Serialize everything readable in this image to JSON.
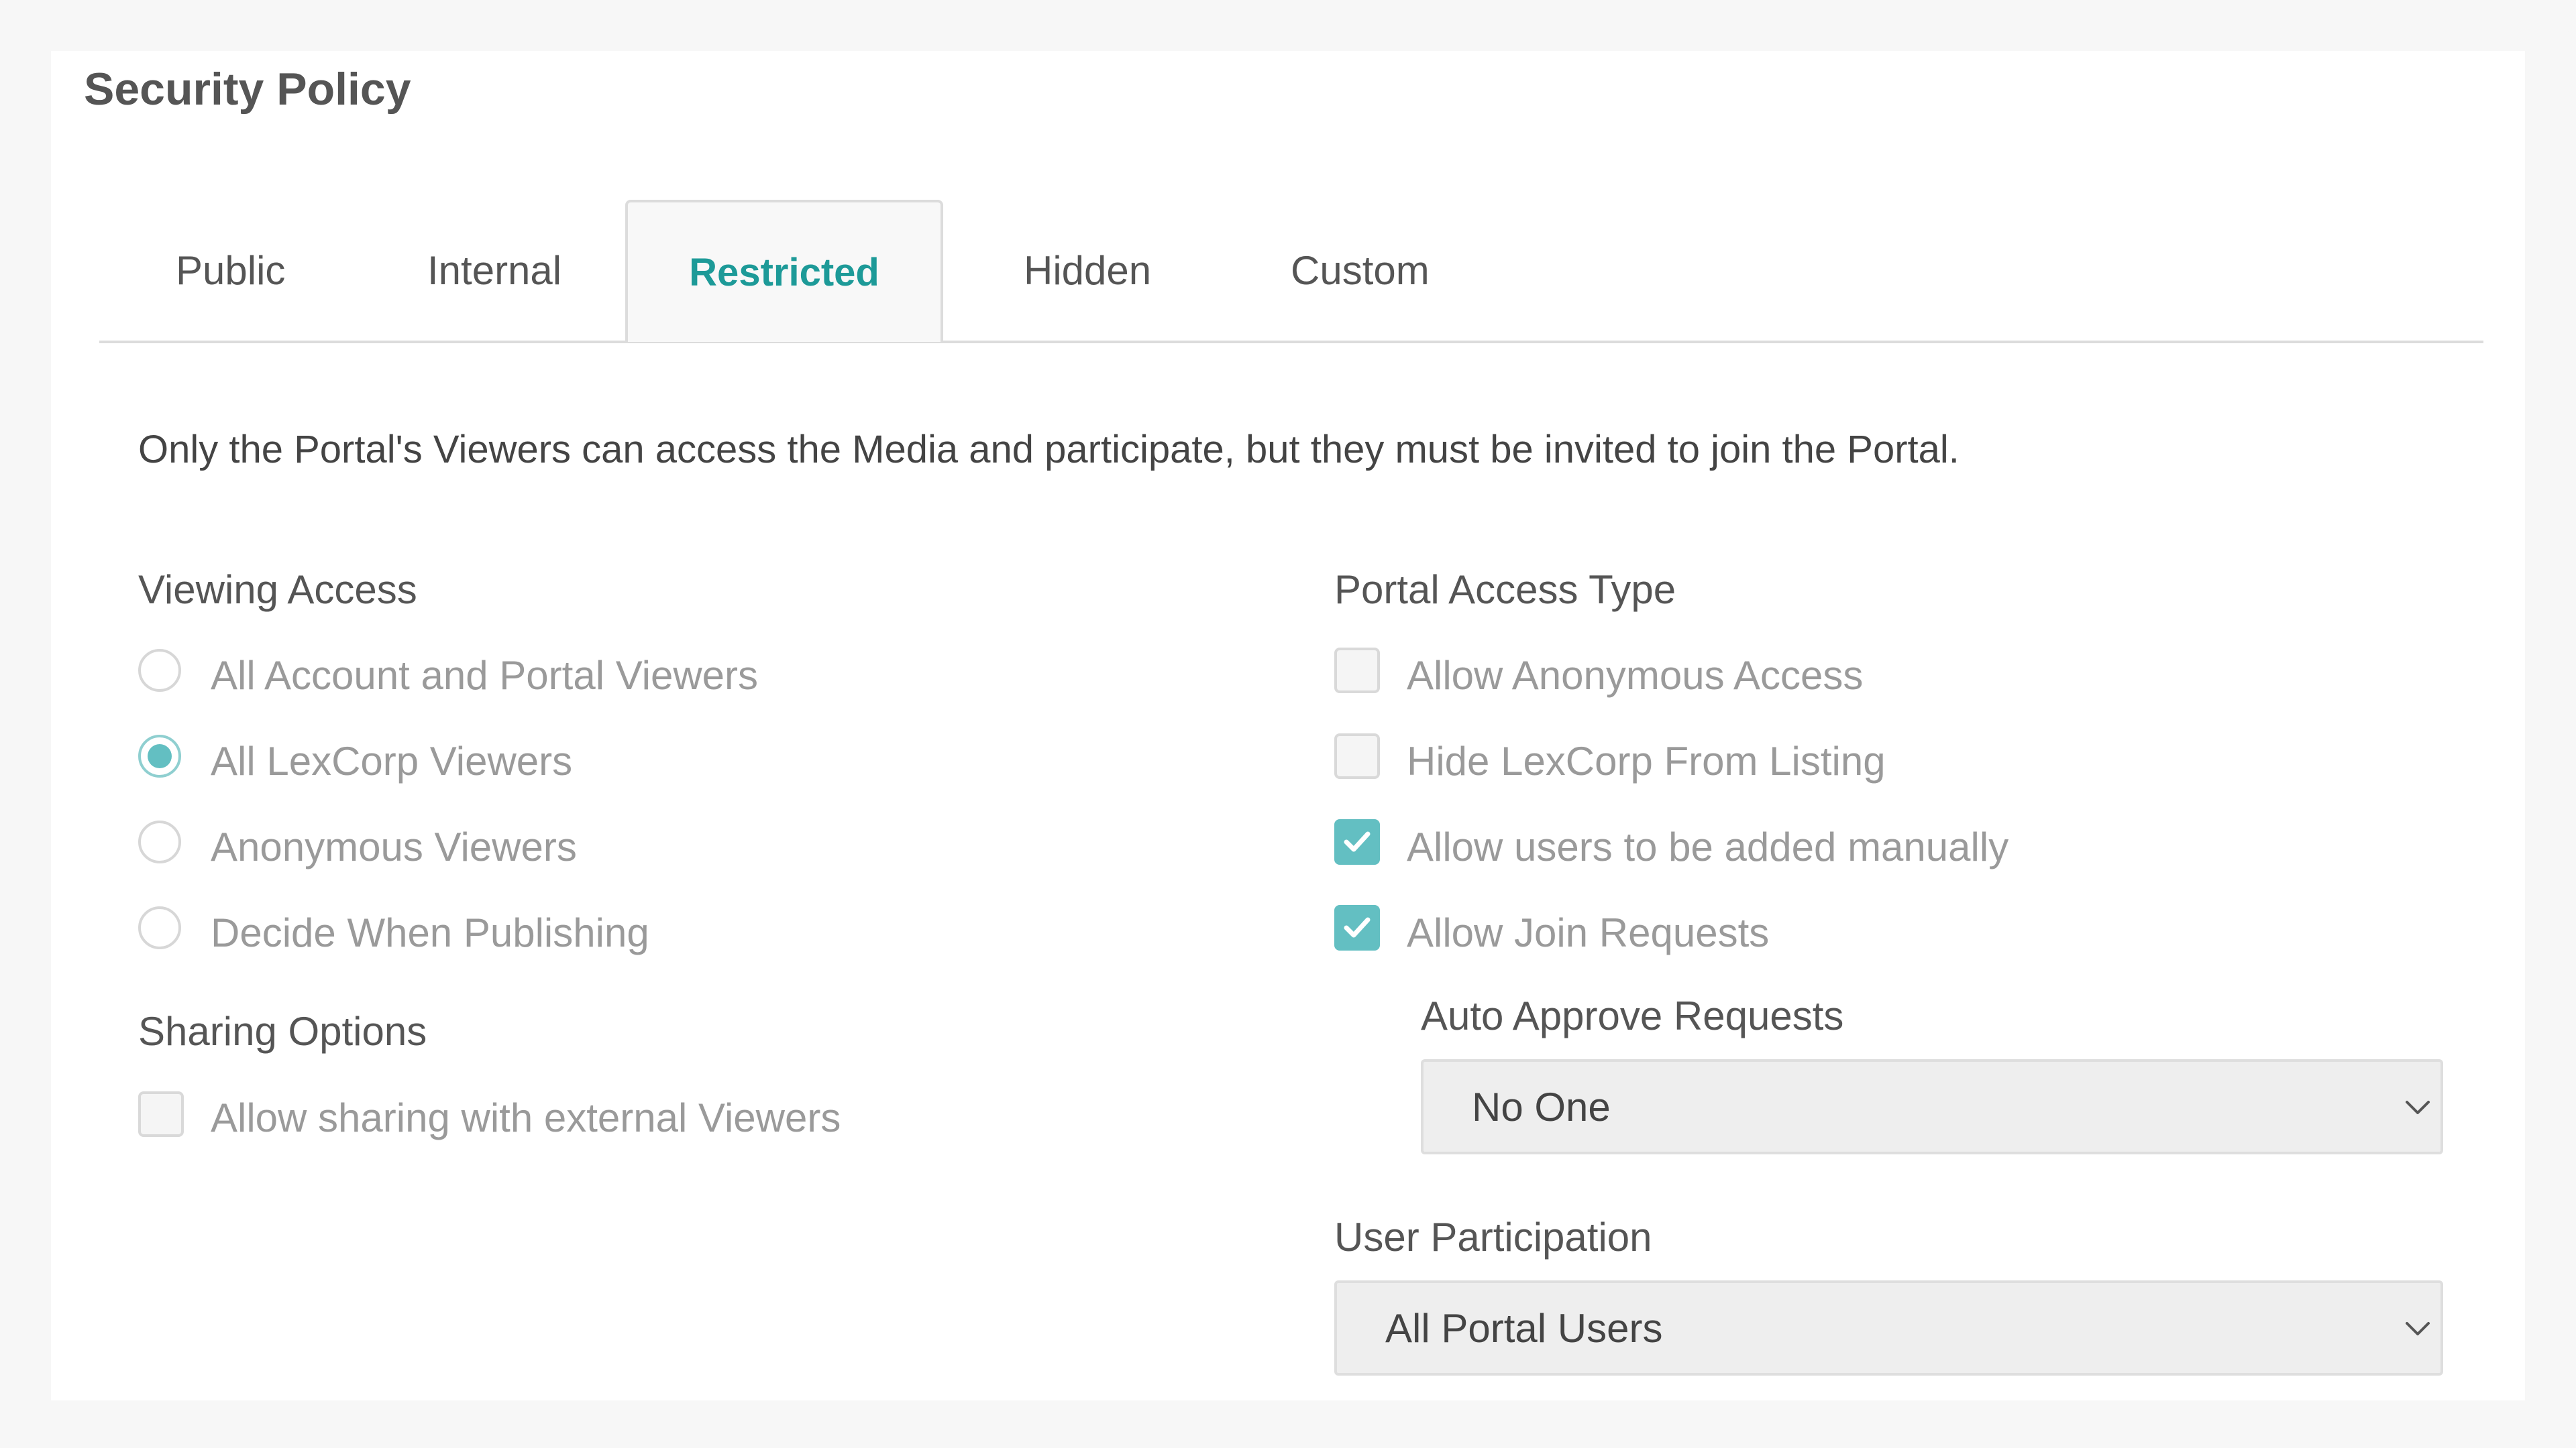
{
  "title": "Security Policy",
  "tabs": [
    {
      "label": "Public",
      "active": false
    },
    {
      "label": "Internal",
      "active": false
    },
    {
      "label": "Restricted",
      "active": true
    },
    {
      "label": "Hidden",
      "active": false
    },
    {
      "label": "Custom",
      "active": false
    }
  ],
  "description": "Only the Portal's Viewers can access the Media and participate, but they must be invited to join the Portal.",
  "viewing_access": {
    "label": "Viewing Access",
    "options": [
      {
        "label": "All Account and Portal Viewers",
        "selected": false
      },
      {
        "label": "All LexCorp Viewers",
        "selected": true
      },
      {
        "label": "Anonymous Viewers",
        "selected": false
      },
      {
        "label": "Decide When Publishing",
        "selected": false
      }
    ]
  },
  "sharing_options": {
    "label": "Sharing Options",
    "allow_external": {
      "label": "Allow sharing with external Viewers",
      "checked": false
    }
  },
  "portal_access_type": {
    "label": "Portal Access Type",
    "options": [
      {
        "label": "Allow Anonymous Access",
        "checked": false
      },
      {
        "label": "Hide LexCorp From Listing",
        "checked": false
      },
      {
        "label": "Allow users to be added manually",
        "checked": true
      },
      {
        "label": "Allow Join Requests",
        "checked": true
      }
    ]
  },
  "auto_approve": {
    "label": "Auto Approve Requests",
    "value": "No One"
  },
  "user_participation": {
    "label": "User Participation",
    "value": "All Portal Users"
  },
  "colors": {
    "accent": "#63bfc2",
    "active_tab_text": "#1d9a98"
  }
}
